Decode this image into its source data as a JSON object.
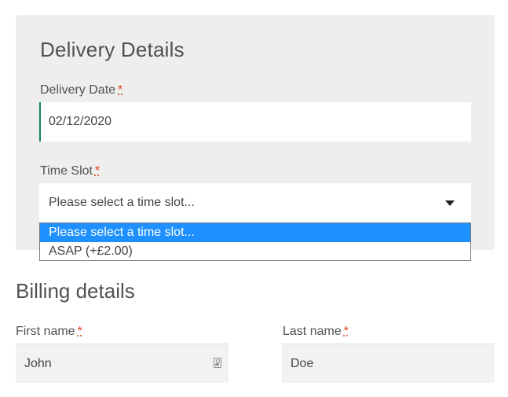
{
  "delivery": {
    "title": "Delivery Details",
    "date_label": "Delivery Date",
    "date_value": "02/12/2020",
    "time_slot_label": "Time Slot",
    "time_slot_selected": "Please select a time slot...",
    "time_slot_options": [
      "Please select a time slot...",
      "ASAP (+£2.00)"
    ],
    "required_mark": "*"
  },
  "billing": {
    "title": "Billing details",
    "first_name_label": "First name",
    "first_name_value": "John",
    "last_name_label": "Last name",
    "last_name_value": "Doe",
    "required_mark": "*"
  },
  "colors": {
    "panel_bg": "#eeeeee",
    "required": "#e2401c",
    "focus_border": "#0f834d",
    "option_highlight": "#1e90ff"
  },
  "icons": {
    "dropdown_caret": "caret-down-icon",
    "password_manager": "password-manager-icon"
  }
}
